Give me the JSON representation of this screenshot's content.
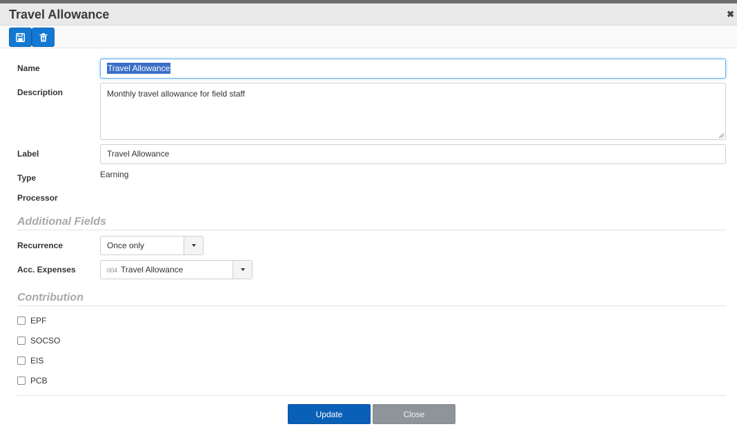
{
  "dialog": {
    "title": "Travel Allowance",
    "close_icon": "close-icon"
  },
  "toolbar": {
    "save_icon": "floppy-disk-icon",
    "delete_icon": "trash-icon",
    "accent": "#1378d2"
  },
  "form": {
    "name": {
      "label": "Name",
      "value": "Travel Allowance",
      "selected": true
    },
    "description": {
      "label": "Description",
      "value": "Monthly travel allowance for field staff"
    },
    "label_field": {
      "label": "Label",
      "value": "Travel Allowance"
    },
    "type": {
      "label": "Type",
      "value": "Earning"
    },
    "processor": {
      "label": "Processor",
      "value": ""
    }
  },
  "additional_fields": {
    "heading": "Additional Fields",
    "recurrence": {
      "label": "Recurrence",
      "value": "Once only"
    },
    "acc_expenses": {
      "label": "Acc. Expenses",
      "code": "004",
      "value": "Travel Allowance"
    }
  },
  "contribution": {
    "heading": "Contribution",
    "items": [
      {
        "label": "EPF",
        "checked": false
      },
      {
        "label": "SOCSO",
        "checked": false
      },
      {
        "label": "EIS",
        "checked": false
      },
      {
        "label": "PCB",
        "checked": false
      }
    ]
  },
  "footer": {
    "update_label": "Update",
    "close_label": "Close",
    "primary_color": "#0a60b7",
    "secondary_color": "#8e949a"
  }
}
